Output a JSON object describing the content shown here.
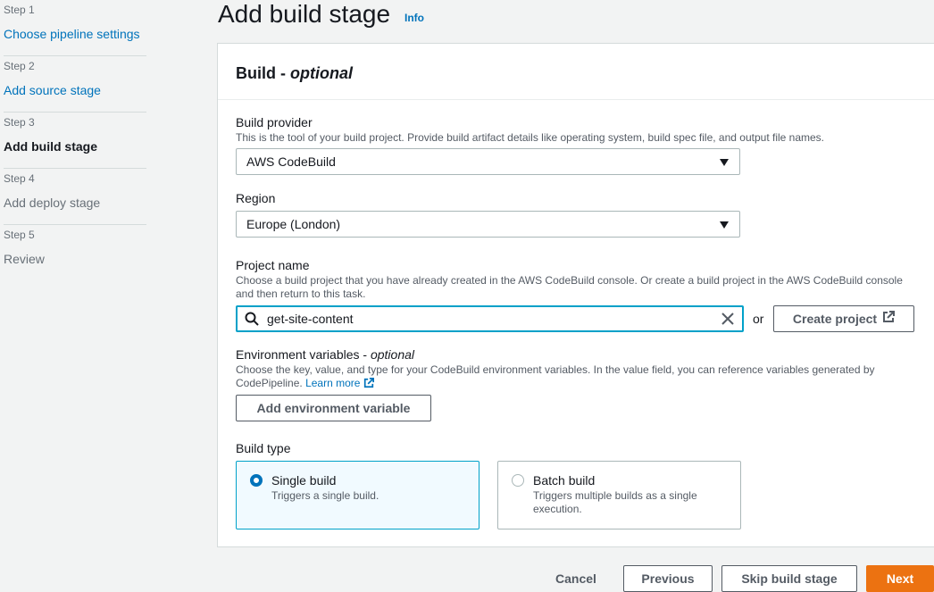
{
  "steps": [
    {
      "num": "Step 1",
      "label": "Choose pipeline settings"
    },
    {
      "num": "Step 2",
      "label": "Add source stage"
    },
    {
      "num": "Step 3",
      "label": "Add build stage"
    },
    {
      "num": "Step 4",
      "label": "Add deploy stage"
    },
    {
      "num": "Step 5",
      "label": "Review"
    }
  ],
  "page": {
    "title": "Add build stage",
    "info": "Info"
  },
  "card": {
    "title": "Build",
    "title_optional": "optional"
  },
  "build_provider": {
    "label": "Build provider",
    "description": "This is the tool of your build project. Provide build artifact details like operating system, build spec file, and output file names.",
    "value": "AWS CodeBuild"
  },
  "region": {
    "label": "Region",
    "value": "Europe (London)"
  },
  "project_name": {
    "label": "Project name",
    "description": "Choose a build project that you have already created in the AWS CodeBuild console. Or create a build project in the AWS CodeBuild console and then return to this task.",
    "value": "get-site-content",
    "or": "or",
    "create_label": "Create project"
  },
  "env_vars": {
    "label": "Environment variables",
    "label_optional": "optional",
    "description": "Choose the key, value, and type for your CodeBuild environment variables. In the value field, you can reference variables generated by CodePipeline.",
    "learn_more": "Learn more",
    "add_label": "Add environment variable"
  },
  "build_type": {
    "label": "Build type",
    "options": [
      {
        "label": "Single build",
        "description": "Triggers a single build.",
        "selected": true
      },
      {
        "label": "Batch build",
        "description": "Triggers multiple builds as a single execution.",
        "selected": false
      }
    ]
  },
  "footer": {
    "cancel": "Cancel",
    "previous": "Previous",
    "skip": "Skip build stage",
    "next": "Next"
  },
  "colors": {
    "link": "#0073bb",
    "primary": "#ec7211",
    "focus": "#00a1c9"
  }
}
